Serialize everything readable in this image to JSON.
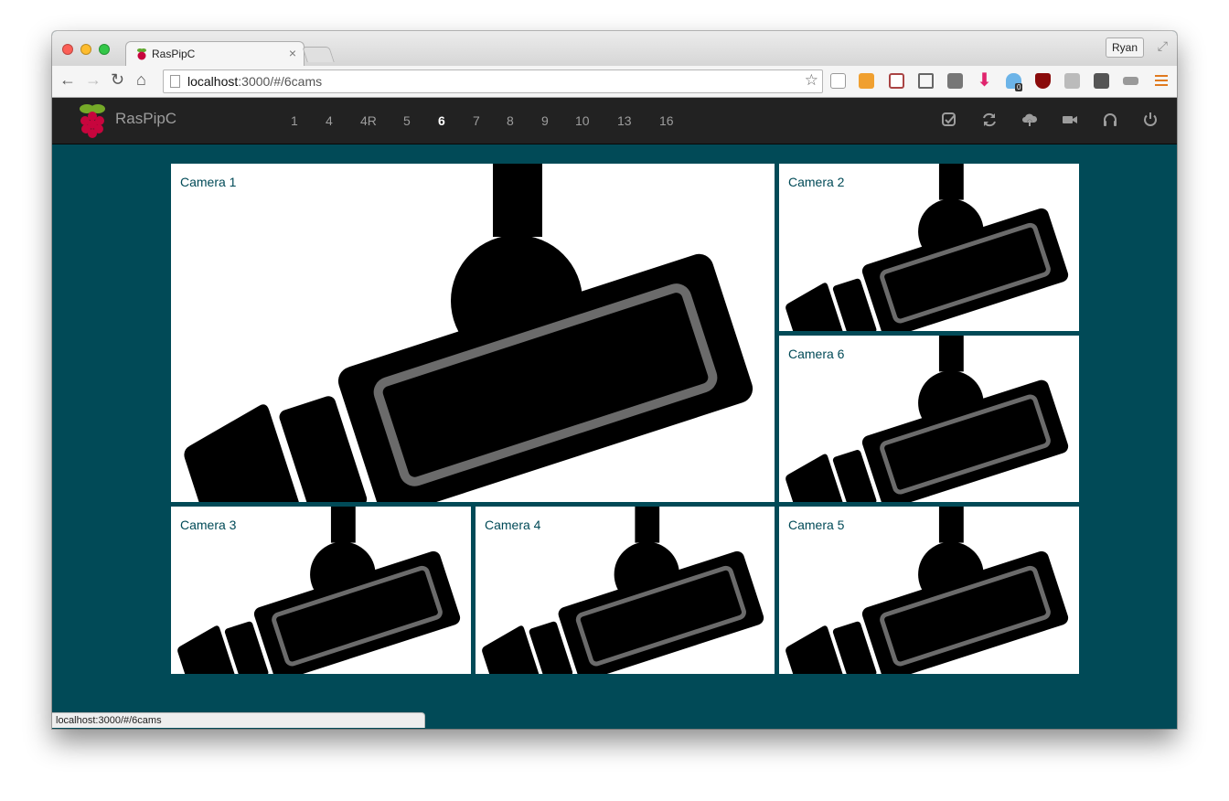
{
  "browser": {
    "tab_title": "RasPipC",
    "tab_close": "×",
    "profile_name": "Ryan",
    "url_host": "localhost",
    "url_path": ":3000/#/6cams",
    "status_url": "localhost:3000/#/6cams",
    "extension_badge": "0"
  },
  "app": {
    "brand": "RasPipC",
    "layouts": [
      "1",
      "4",
      "4R",
      "5",
      "6",
      "7",
      "8",
      "9",
      "10",
      "13",
      "16"
    ],
    "active_layout": "6",
    "actions": [
      "check-icon",
      "refresh-icon",
      "cloud-upload-icon",
      "video-camera-icon",
      "headphones-icon",
      "power-icon"
    ]
  },
  "cameras": [
    "Camera 1",
    "Camera 2",
    "Camera 6",
    "Camera 3",
    "Camera 4",
    "Camera 5"
  ],
  "colors": {
    "page_background": "#014a57",
    "navbar": "#222222",
    "camera_label": "#014a57"
  }
}
